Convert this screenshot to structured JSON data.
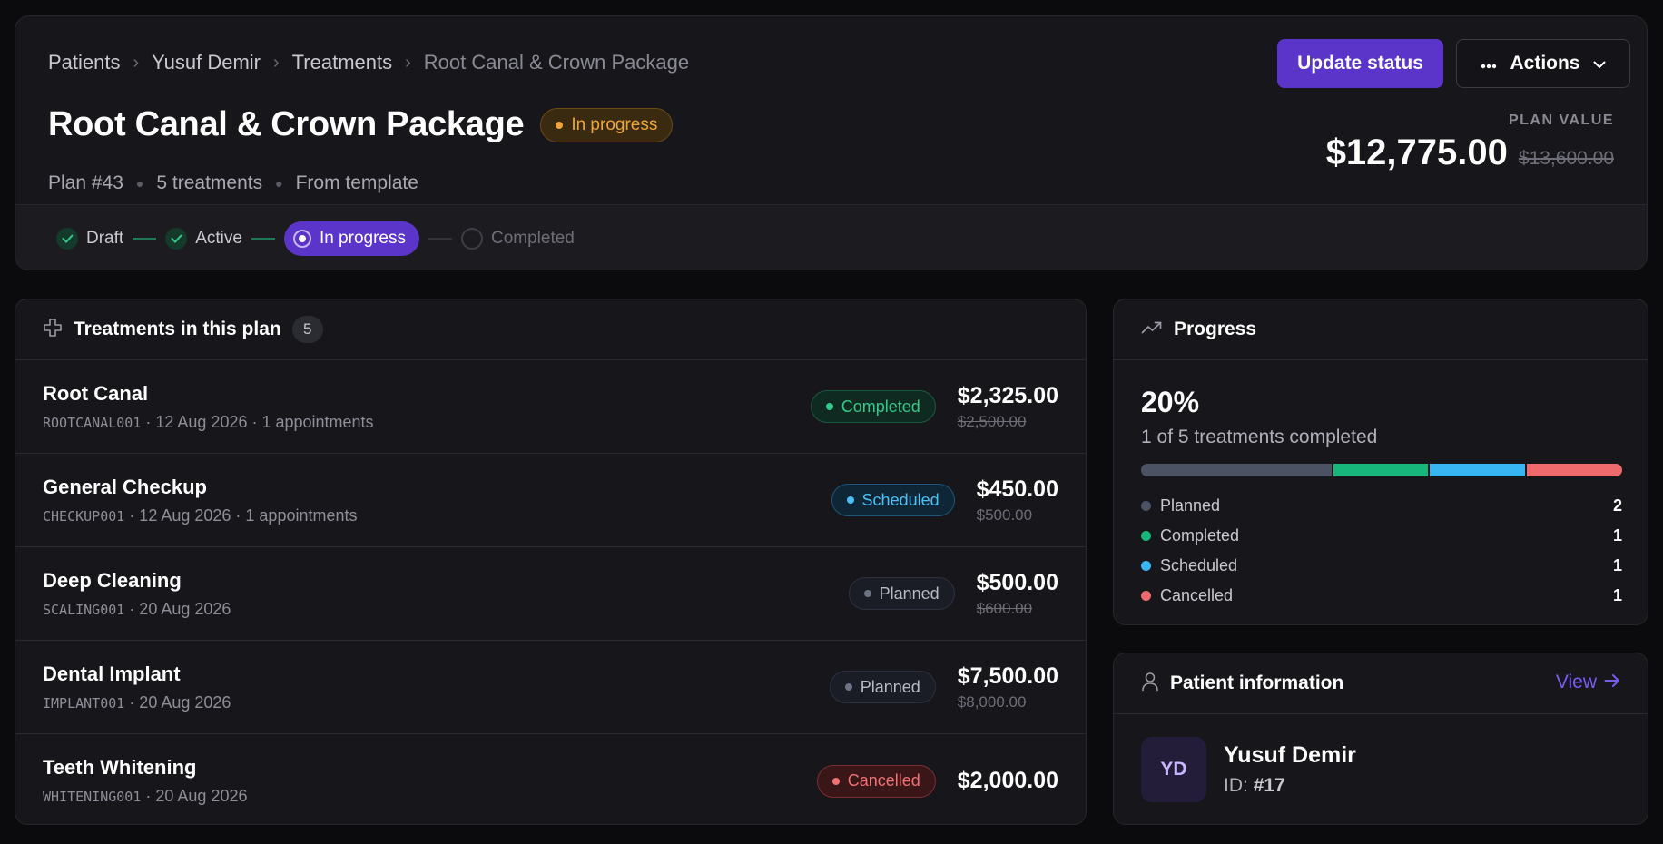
{
  "breadcrumb": [
    "Patients",
    "Yusuf Demir",
    "Treatments",
    "Root Canal & Crown Package"
  ],
  "header": {
    "title": "Root Canal & Crown Package",
    "status": "In progress",
    "plan_number": "Plan #43",
    "treatments_count": "5 treatments",
    "source": "From template",
    "update_status_label": "Update status",
    "actions_label": "Actions",
    "plan_value_label": "PLAN VALUE",
    "plan_value": "$12,775.00",
    "plan_value_original": "$13,600.00"
  },
  "stepper": {
    "steps": [
      {
        "label": "Draft",
        "state": "done"
      },
      {
        "label": "Active",
        "state": "done"
      },
      {
        "label": "In progress",
        "state": "current"
      },
      {
        "label": "Completed",
        "state": "pending"
      }
    ]
  },
  "treatments": {
    "title": "Treatments in this plan",
    "count": "5",
    "items": [
      {
        "name": "Root Canal",
        "code": "ROOTCANAL001",
        "details": " · 12 Aug 2026 · 1 appointments",
        "status": "Completed",
        "price": "$2,325.00",
        "original_price": "$2,500.00"
      },
      {
        "name": "General Checkup",
        "code": "CHECKUP001",
        "details": " · 12 Aug 2026 · 1 appointments",
        "status": "Scheduled",
        "price": "$450.00",
        "original_price": "$500.00"
      },
      {
        "name": "Deep Cleaning",
        "code": "SCALING001",
        "details": " · 20 Aug 2026",
        "status": "Planned",
        "price": "$500.00",
        "original_price": "$600.00"
      },
      {
        "name": "Dental Implant",
        "code": "IMPLANT001",
        "details": " · 20 Aug 2026",
        "status": "Planned",
        "price": "$7,500.00",
        "original_price": "$8,000.00"
      },
      {
        "name": "Teeth Whitening",
        "code": "WHITENING001",
        "details": " · 20 Aug 2026",
        "status": "Cancelled",
        "price": "$2,000.00",
        "original_price": ""
      }
    ]
  },
  "progress": {
    "title": "Progress",
    "percent": "20%",
    "summary": "1 of 5 treatments completed",
    "segments": [
      {
        "label": "Planned",
        "count": "2",
        "value": 2,
        "color": "#4b5263"
      },
      {
        "label": "Completed",
        "count": "1",
        "value": 1,
        "color": "#17b77b"
      },
      {
        "label": "Scheduled",
        "count": "1",
        "value": 1,
        "color": "#38b6f2"
      },
      {
        "label": "Cancelled",
        "count": "1",
        "value": 1,
        "color": "#ef6a6d"
      }
    ]
  },
  "patient": {
    "title": "Patient information",
    "view_label": "View",
    "initials": "YD",
    "name": "Yusuf Demir",
    "id_label": "ID:",
    "id_value": "#17"
  },
  "colors": {
    "accent": "#5b35c9",
    "amber": "#f0a53a"
  }
}
